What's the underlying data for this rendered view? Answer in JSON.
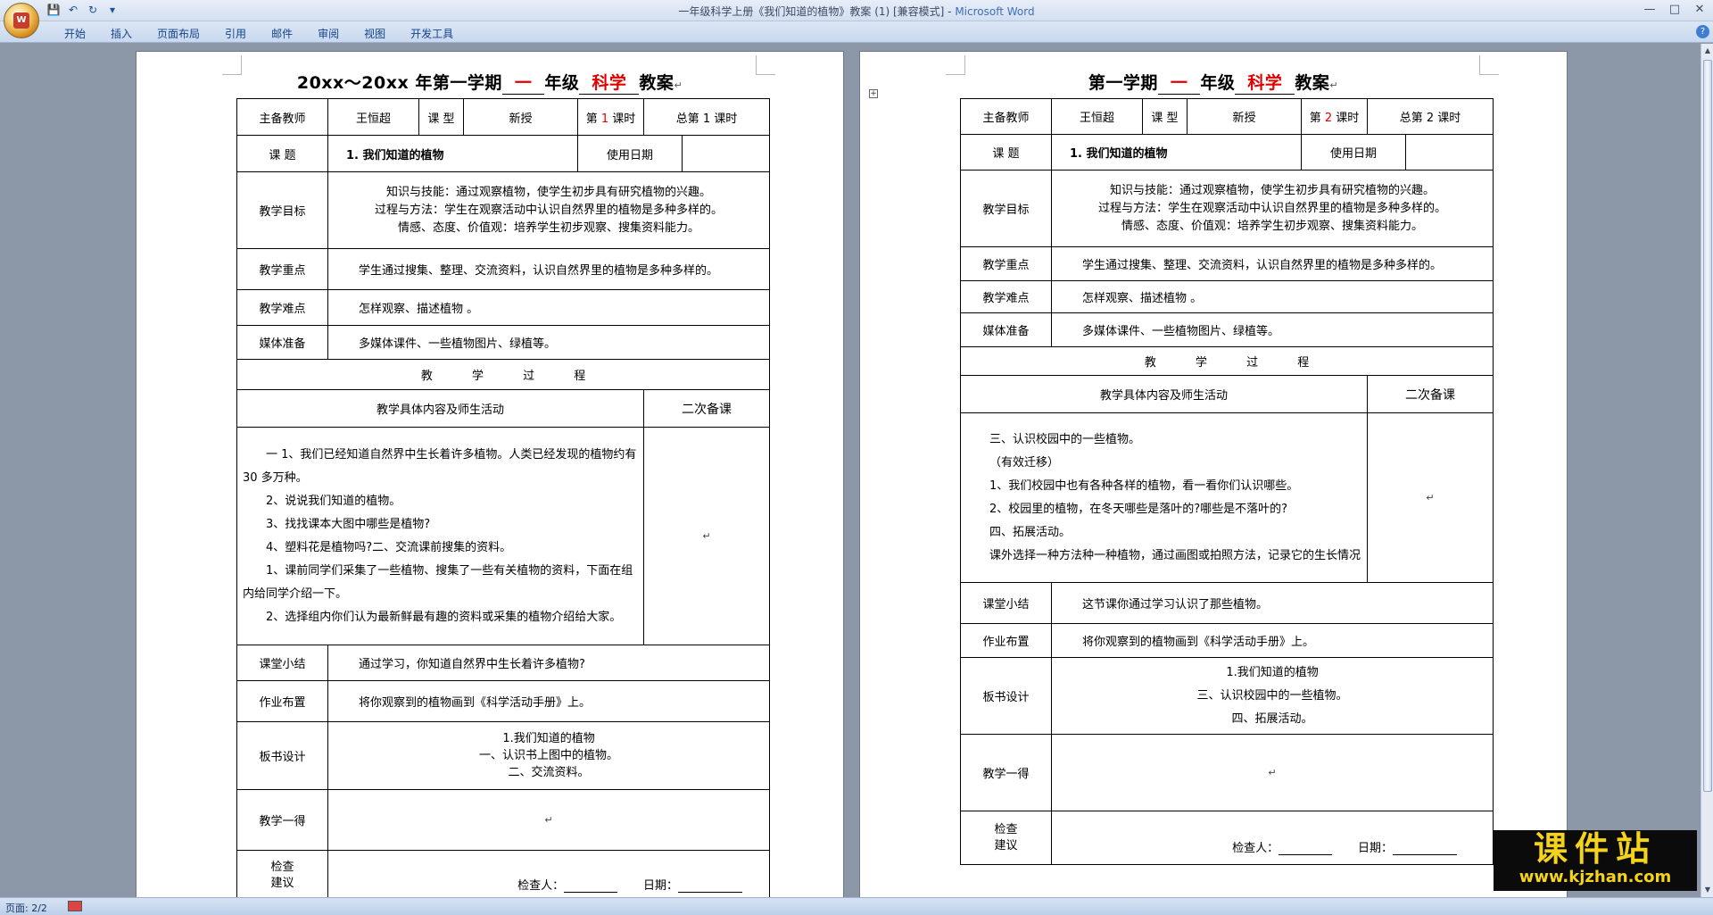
{
  "window": {
    "title": "一年级科学上册《我们知道的植物》教案 (1) [兼容模式] - ",
    "app_name": "Microsoft Word"
  },
  "ribbon": {
    "tabs": [
      "开始",
      "插入",
      "页面布局",
      "引用",
      "邮件",
      "审阅",
      "视图",
      "开发工具"
    ]
  },
  "status_bar": {
    "page_info": "页面: 2/2"
  },
  "watermark": {
    "text": "课件站",
    "url": "www.kjzhan.com"
  },
  "page1": {
    "title_prefix": "20xx～20xx 年第一学期",
    "grade": "一",
    "grade_suffix": "年级",
    "subject": "科学",
    "title_suffix": "教案",
    "labels": {
      "teacher": "主备教师",
      "course_type": "课 型",
      "topic": "课 题",
      "use_date": "使用日期",
      "goals": "教学目标",
      "key_points": "教学重点",
      "difficulties": "教学难点",
      "media": "媒体准备",
      "process": "教 学 过 程",
      "activities": "教学具体内容及师生活动",
      "second_prep": "二次备课",
      "summary": "课堂小结",
      "homework": "作业布置",
      "board": "板书设计",
      "reflection": "教学一得",
      "check": "检查",
      "suggestion": "建议"
    },
    "teacher": "王恒超",
    "course_type": "新授",
    "lesson_no_prefix": "第",
    "lesson_no": "1",
    "lesson_no_suffix": "课时",
    "total_lessons": "总第 1 课时",
    "topic": "1. 我们知道的植物",
    "goals": [
      "知识与技能：通过观察植物，使学生初步具有研究植物的兴趣。",
      "过程与方法：学生在观察活动中认识自然界里的植物是多种多样的。",
      "情感、态度、价值观：培养学生初步观察、搜集资料能力。"
    ],
    "key_points": "学生通过搜集、整理、交流资料，认识自然界里的植物是多种多样的。",
    "difficulties": "怎样观察、描述植物 。",
    "media": "多媒体课件、一些植物图片、绿植等。",
    "activities": [
      "一 1、我们已经知道自然界中生长着许多植物。人类已经发现的植物约有 30 多万种。",
      "2、说说我们知道的植物。",
      "3、找找课本大图中哪些是植物?",
      "4、塑料花是植物吗?二、交流课前搜集的资料。",
      "1、课前同学们采集了一些植物、搜集了一些有关植物的资料，下面在组内给同学介绍一下。",
      "2、选择组内你们认为最新鲜最有趣的资料或采集的植物介绍给大家。"
    ],
    "summary": "通过学习，你知道自然界中生长着许多植物?",
    "homework": "将你观察到的植物画到《科学活动手册》上。",
    "board": [
      "1.我们知道的植物",
      "一、认识书上图中的植物。",
      "二、交流资料。"
    ],
    "checker_label": "检查人：",
    "date_label": "日期："
  },
  "page2": {
    "title_prefix": "第一学期",
    "grade": "一",
    "grade_suffix": "年级",
    "subject": "科学",
    "title_suffix": "教案",
    "teacher": "王恒超",
    "course_type": "新授",
    "lesson_no_prefix": "第",
    "lesson_no": "2",
    "lesson_no_suffix": "课时",
    "total_lessons": "总第 2 课时",
    "topic": "1. 我们知道的植物",
    "goals": [
      "知识与技能：通过观察植物，使学生初步具有研究植物的兴趣。",
      "过程与方法：学生在观察活动中认识自然界里的植物是多种多样的。",
      "情感、态度、价值观：培养学生初步观察、搜集资料能力。"
    ],
    "key_points": "学生通过搜集、整理、交流资料，认识自然界里的植物是多种多样的。",
    "difficulties": "怎样观察、描述植物 。",
    "media": "多媒体课件、一些植物图片、绿植等。",
    "activities": [
      "三、认识校园中的一些植物。",
      "（有效迁移）",
      "1、我们校园中也有各种各样的植物，看一看你们认识哪些。",
      "2、校园里的植物，在冬天哪些是落叶的?哪些是不落叶的?",
      "四、拓展活动。",
      "课外选择一种方法种一种植物，通过画图或拍照方法，记录它的生长情况"
    ],
    "summary": "这节课你通过学习认识了那些植物。",
    "homework": "将你观察到的植物画到《科学活动手册》上。",
    "board": [
      "1.我们知道的植物",
      "三、认识校园中的一些植物。",
      "四、拓展活动。"
    ],
    "checker_label": "检查人：",
    "date_label": "日期："
  }
}
